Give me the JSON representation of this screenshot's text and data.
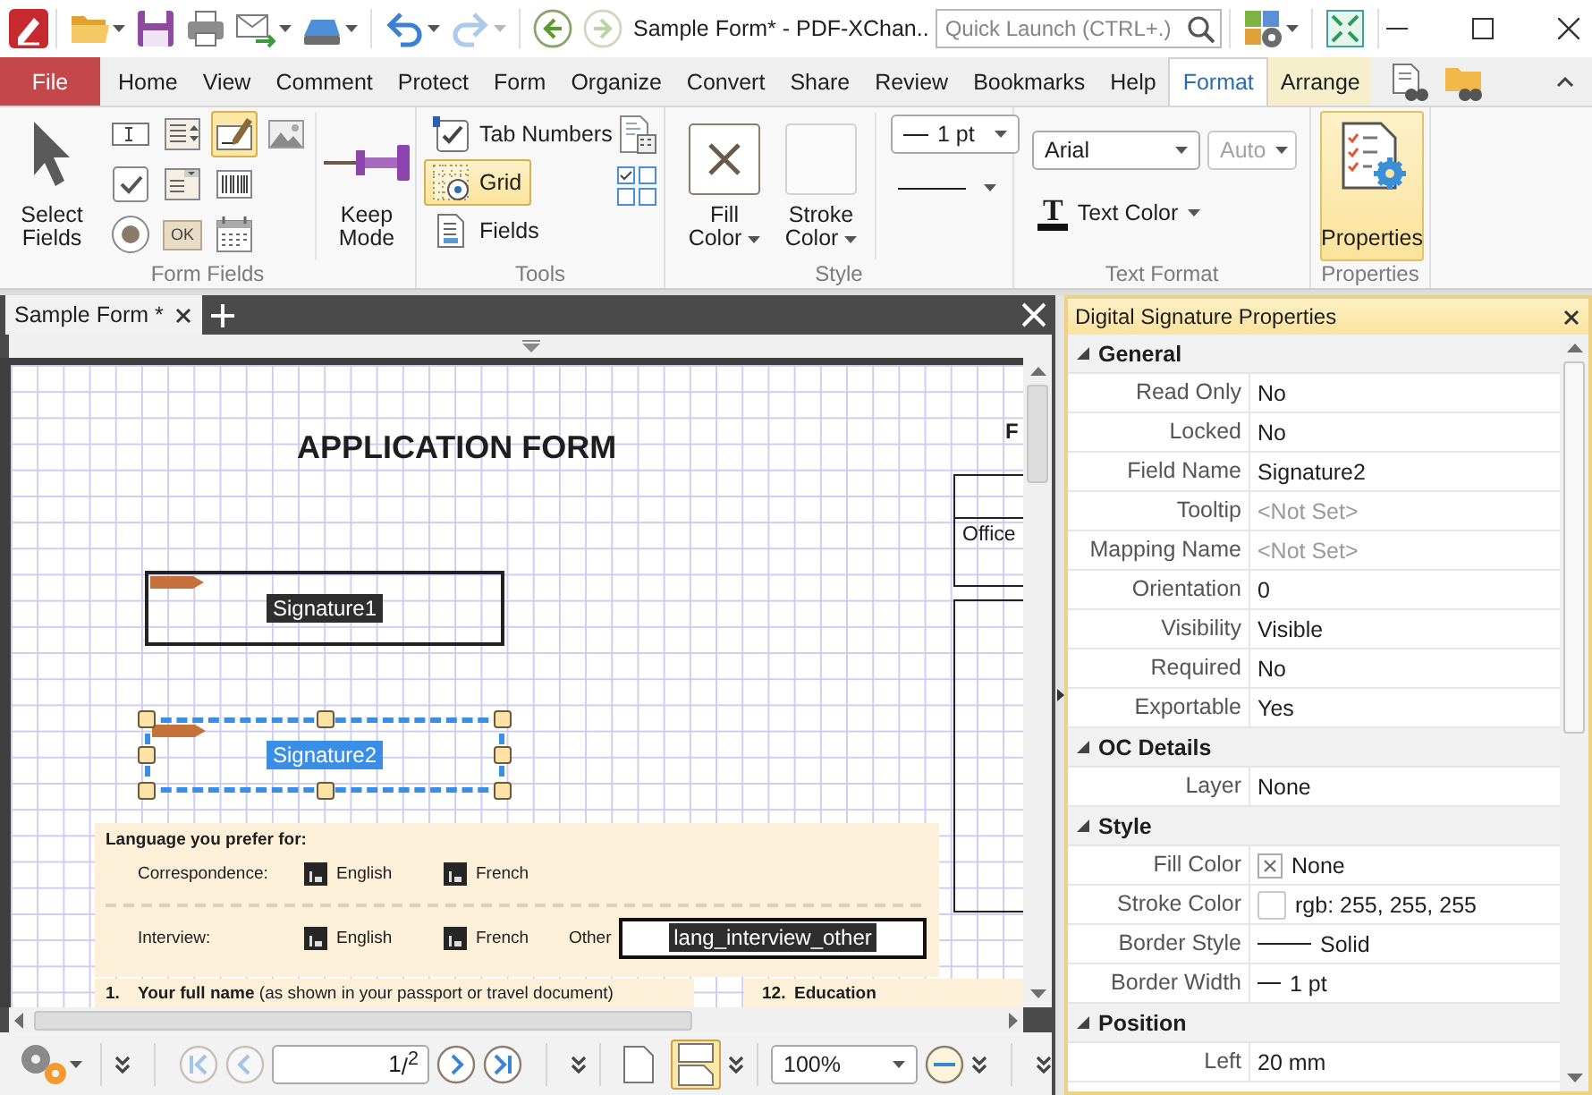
{
  "title_bar": {
    "button_groups": [
      [
        {
          "kind": "open",
          "dropdown": true,
          "disabled": false
        },
        {
          "kind": "save",
          "dropdown": false,
          "disabled": false
        },
        {
          "kind": "print",
          "dropdown": false,
          "disabled": false
        },
        {
          "kind": "email",
          "dropdown": true,
          "disabled": false
        },
        {
          "kind": "scan",
          "dropdown": true,
          "disabled": false
        }
      ],
      [
        {
          "kind": "undo",
          "dropdown": true,
          "disabled": false
        },
        {
          "kind": "redo",
          "dropdown": true,
          "disabled": true
        }
      ],
      [
        {
          "kind": "back",
          "dropdown": false,
          "disabled": false
        },
        {
          "kind": "forward",
          "dropdown": false,
          "disabled": true
        }
      ]
    ],
    "title": "Sample Form* - PDF-XChan..",
    "search": {
      "placeholder": "Quick Launch (CTRL+.)"
    },
    "tools": [
      {
        "kind": "ui-options",
        "dropdown": true
      },
      {
        "kind": "fullscreen",
        "dropdown": false
      }
    ]
  },
  "ribbon_tabs": [
    {
      "label": "File",
      "kind": "file",
      "selected": false
    },
    {
      "label": "Home",
      "kind": "normal",
      "selected": false
    },
    {
      "label": "View",
      "kind": "normal",
      "selected": false
    },
    {
      "label": "Comment",
      "kind": "normal",
      "selected": false
    },
    {
      "label": "Protect",
      "kind": "normal",
      "selected": false
    },
    {
      "label": "Form",
      "kind": "normal",
      "selected": false
    },
    {
      "label": "Organize",
      "kind": "normal",
      "selected": false
    },
    {
      "label": "Convert",
      "kind": "normal",
      "selected": false
    },
    {
      "label": "Share",
      "kind": "normal",
      "selected": false
    },
    {
      "label": "Review",
      "kind": "normal",
      "selected": false
    },
    {
      "label": "Bookmarks",
      "kind": "normal",
      "selected": false
    },
    {
      "label": "Help",
      "kind": "normal",
      "selected": false
    },
    {
      "label": "Format",
      "kind": "contextual",
      "selected": true
    },
    {
      "label": "Arrange",
      "kind": "contextual",
      "selected": false
    }
  ],
  "ribbon": {
    "form_fields": {
      "label": "Form Fields",
      "select_button": {
        "label": "Select Fields",
        "selected": false
      },
      "tool_rows": [
        [
          {
            "kind": "text-field",
            "selected": false
          },
          {
            "kind": "list-box",
            "selected": false
          },
          {
            "kind": "signature",
            "selected": true
          },
          {
            "kind": "image",
            "selected": false
          }
        ],
        [
          {
            "kind": "check-box",
            "selected": false
          },
          {
            "kind": "combo-box",
            "selected": false
          },
          {
            "kind": "barcode",
            "selected": false
          }
        ],
        [
          {
            "kind": "radio-button",
            "selected": false
          },
          {
            "kind": "push-button",
            "selected": false,
            "text": "OK"
          },
          {
            "kind": "date",
            "selected": false
          }
        ]
      ],
      "keep_mode": {
        "label": "Keep Mode",
        "selected": false
      }
    },
    "tools": {
      "label": "Tools",
      "buttons": [
        {
          "kind": "tab-numbers",
          "label": "Tab Numbers",
          "selected": false
        },
        {
          "kind": "grid",
          "label": "Grid",
          "selected": true
        },
        {
          "kind": "fields",
          "label": "Fields",
          "selected": false
        }
      ],
      "icon_buttons": [
        {
          "kind": "calculation-order"
        },
        {
          "kind": "arrange-fields"
        }
      ]
    },
    "style": {
      "label": "Style",
      "color_buttons": [
        {
          "label": "Fill Color",
          "kind": "no-color"
        },
        {
          "label": "Stroke Color",
          "kind": "blank"
        }
      ],
      "line_width": {
        "value": "1 pt"
      }
    },
    "text_format": {
      "label": "Text Format",
      "font": {
        "value": "Arial",
        "disabled": false
      },
      "size": {
        "value": "Auto",
        "disabled": true
      },
      "text_color": {
        "label": "Text Color",
        "glyph": "T"
      }
    },
    "properties": {
      "label": "Properties",
      "button": {
        "label": "Properties",
        "selected": true
      }
    }
  },
  "document": {
    "tabs": [
      {
        "label": "Sample Form *",
        "selected": true
      }
    ],
    "page": {
      "title": "APPLICATION FORM",
      "corner_letter": "F",
      "office_label": "Office",
      "signature_fields": [
        {
          "name": "Signature1",
          "selected": false
        },
        {
          "name": "Signature2",
          "selected": true
        }
      ],
      "language": {
        "heading": "Language you prefer for:",
        "rows": [
          {
            "label": "Correspondence:",
            "options": [
              "English",
              "French"
            ]
          },
          {
            "label": "Interview:",
            "options": [
              "English",
              "French"
            ],
            "other": {
              "label": "Other",
              "field_name": "lang_interview_other"
            }
          }
        ]
      },
      "full_name_row": {
        "number": "1.",
        "text": "**Your full name** (as shown in your passport or travel document)"
      },
      "education_row": {
        "number": "12.",
        "text": "Education"
      }
    }
  },
  "bottom_toolbar": {
    "nav_back": [
      {
        "kind": "first",
        "disabled": true
      },
      {
        "kind": "previous",
        "disabled": true
      }
    ],
    "page": {
      "value": "1",
      "total": "/$^{2}$"
    },
    "nav_forward": [
      {
        "kind": "next",
        "disabled": false
      },
      {
        "kind": "last",
        "disabled": false
      }
    ],
    "views": [
      {
        "kind": "single-page",
        "selected": false
      },
      {
        "kind": "continuous",
        "selected": true
      }
    ],
    "zoom": {
      "value": "100%"
    }
  },
  "properties_panel": {
    "title": "Digital Signature Properties",
    "sections": [
      {
        "title": "General",
        "expanded": true,
        "rows": [
          {
            "name": "Read Only",
            "value": "No",
            "kind": "text"
          },
          {
            "name": "Locked",
            "value": "No",
            "kind": "text"
          },
          {
            "name": "Field Name",
            "value": "Signature2",
            "kind": "text"
          },
          {
            "name": "Tooltip",
            "value": "<Not Set>",
            "kind": "unset"
          },
          {
            "name": "Mapping Name",
            "value": "<Not Set>",
            "kind": "unset"
          },
          {
            "name": "Orientation",
            "value": "0",
            "kind": "text"
          },
          {
            "name": "Visibility",
            "value": "Visible",
            "kind": "text"
          },
          {
            "name": "Required",
            "value": "No",
            "kind": "text"
          },
          {
            "name": "Exportable",
            "value": "Yes",
            "kind": "text"
          }
        ]
      },
      {
        "title": "OC Details",
        "expanded": true,
        "rows": [
          {
            "name": "Layer",
            "value": "None",
            "kind": "text"
          }
        ]
      },
      {
        "title": "Style",
        "expanded": true,
        "rows": [
          {
            "name": "Fill Color",
            "value": "None",
            "kind": "no-color"
          },
          {
            "name": "Stroke Color",
            "value": "rgb: 255, 255, 255",
            "kind": "color",
            "color": "#ffffff"
          },
          {
            "name": "Border Style",
            "value": "Solid",
            "kind": "line-style"
          },
          {
            "name": "Border Width",
            "value": "1 pt",
            "kind": "line-width"
          }
        ]
      },
      {
        "title": "Position",
        "expanded": true,
        "rows": [
          {
            "name": "Left",
            "value": "20 mm",
            "kind": "text"
          }
        ]
      }
    ]
  }
}
